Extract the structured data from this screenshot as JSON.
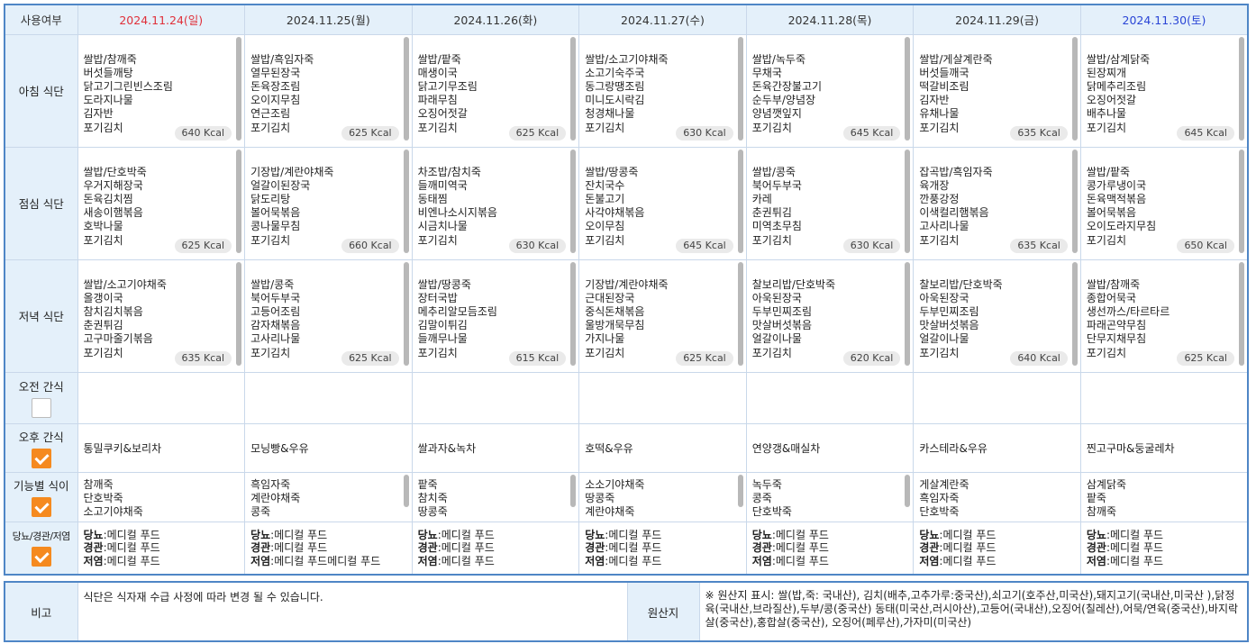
{
  "header": {
    "col_label": "사용여부",
    "days": [
      {
        "date": "2024.11.24(일)",
        "type": "sun"
      },
      {
        "date": "2024.11.25(월)",
        "type": ""
      },
      {
        "date": "2024.11.26(화)",
        "type": ""
      },
      {
        "date": "2024.11.27(수)",
        "type": ""
      },
      {
        "date": "2024.11.28(목)",
        "type": ""
      },
      {
        "date": "2024.11.29(금)",
        "type": ""
      },
      {
        "date": "2024.11.30(토)",
        "type": "sat"
      }
    ]
  },
  "meals": [
    {
      "label": "아침 식단",
      "days": [
        {
          "items": [
            "쌀밥/참깨죽",
            "버섯들깨탕",
            "닭고기그린빈스조림",
            "도라지나물",
            "김자반",
            "포기김치"
          ],
          "kcal": "640 Kcal"
        },
        {
          "items": [
            "쌀밥/흑임자죽",
            "열무된장국",
            "돈육장조림",
            "오이지무침",
            "연근조림",
            "포기김치"
          ],
          "kcal": "625 Kcal"
        },
        {
          "items": [
            "쌀밥/팥죽",
            "매생이국",
            "닭고기무조림",
            "파래무침",
            "오징어젓갈",
            "포기김치"
          ],
          "kcal": "625 Kcal"
        },
        {
          "items": [
            "쌀밥/소고기야채죽",
            "소고기숙주국",
            "동그랑땡조림",
            "미니도시락김",
            "청경채나물",
            "포기김치"
          ],
          "kcal": "630 Kcal"
        },
        {
          "items": [
            "쌀밥/녹두죽",
            "무채국",
            "돈육간장불고기",
            "순두부/양념장",
            "양념깻잎지",
            "포기김치"
          ],
          "kcal": "645 Kcal"
        },
        {
          "items": [
            "쌀밥/게살계란죽",
            "버섯들깨국",
            "떡갈비조림",
            "김자반",
            "유채나물",
            "포기김치"
          ],
          "kcal": "635 Kcal"
        },
        {
          "items": [
            "쌀밥/삼계닭죽",
            "된장찌개",
            "닭메추리조림",
            "오징어젓갈",
            "배추나물",
            "포기김치"
          ],
          "kcal": "645 Kcal"
        }
      ]
    },
    {
      "label": "점심 식단",
      "days": [
        {
          "items": [
            "쌀밥/단호박죽",
            "우거지해장국",
            "돈육김치찜",
            "새송이햄볶음",
            "호박나물",
            "포기김치"
          ],
          "kcal": "625 Kcal"
        },
        {
          "items": [
            "기장밥/계란야채죽",
            "얼갈이된장국",
            "닭도리탕",
            "볼어묵볶음",
            "콩나물무침",
            "포기김치"
          ],
          "kcal": "660 Kcal"
        },
        {
          "items": [
            "차조밥/참치죽",
            "들깨미역국",
            "동태찜",
            "비엔나소시지볶음",
            "시금치나물",
            "포기김치"
          ],
          "kcal": "630 Kcal"
        },
        {
          "items": [
            "쌀밥/땅콩죽",
            "잔치국수",
            "돈불고기",
            "사각야채볶음",
            "오이무침",
            "포기김치"
          ],
          "kcal": "645 Kcal"
        },
        {
          "items": [
            "쌀밥/콩죽",
            "북어두부국",
            "카레",
            "춘권튀김",
            "미역초무침",
            "포기김치"
          ],
          "kcal": "630 Kcal"
        },
        {
          "items": [
            "잡곡밥/흑임자죽",
            "육개장",
            "깐풍강정",
            "이색컬리햄볶음",
            "고사리나물",
            "포기김치"
          ],
          "kcal": "635 Kcal"
        },
        {
          "items": [
            "쌀밥/팥죽",
            "콩가루냉이국",
            "돈육맥적볶음",
            "볼어묵볶음",
            "오이도라지무침",
            "포기김치"
          ],
          "kcal": "650 Kcal"
        }
      ]
    },
    {
      "label": "저녁 식단",
      "days": [
        {
          "items": [
            "쌀밥/소고기야채죽",
            "올갱이국",
            "참치김치볶음",
            "춘권튀김",
            "고구마줄기볶음",
            "포기김치"
          ],
          "kcal": "635 Kcal"
        },
        {
          "items": [
            "쌀밥/콩죽",
            "북어두부국",
            "고등어조림",
            "감자채볶음",
            "고사리나물",
            "포기김치"
          ],
          "kcal": "625 Kcal"
        },
        {
          "items": [
            "쌀밥/땅콩죽",
            "장터국밥",
            "메추리알모듬조림",
            "김말이튀김",
            "들깨무나물",
            "포기김치"
          ],
          "kcal": "615 Kcal"
        },
        {
          "items": [
            "기장밥/계란야채죽",
            "근대된장국",
            "중식돈채볶음",
            "울방개묵무침",
            "가지나물",
            "포기김치"
          ],
          "kcal": "625 Kcal"
        },
        {
          "items": [
            "찰보리밥/단호박죽",
            "아욱된장국",
            "두부민찌조림",
            "맛살버섯볶음",
            "얼갈이나물",
            "포기김치"
          ],
          "kcal": "620 Kcal"
        },
        {
          "items": [
            "찰보리밥/단호박죽",
            "아욱된장국",
            "두부민찌조림",
            "맛살버섯볶음",
            "얼갈이나물",
            "포기김치"
          ],
          "kcal": "640 Kcal"
        },
        {
          "items": [
            "쌀밥/참깨죽",
            "종합어묵국",
            "생선까스/타르타르",
            "파래곤약무침",
            "단무지채무침",
            "포기김치"
          ],
          "kcal": "625 Kcal"
        }
      ]
    }
  ],
  "am_snack": {
    "label": "오전 간식",
    "checked": false,
    "items": [
      "",
      "",
      "",
      "",
      "",
      "",
      ""
    ]
  },
  "pm_snack": {
    "label": "오후 간식",
    "checked": true,
    "items": [
      "통밀쿠키&보리차",
      "모닝빵&우유",
      "쌀과자&녹차",
      "호떡&우유",
      "연양갱&매실차",
      "카스테라&우유",
      "찐고구마&둥굴레차"
    ]
  },
  "functional": {
    "label": "기능별 식이",
    "checked": true,
    "days": [
      [
        "참깨죽",
        "단호박죽",
        "소고기야채죽"
      ],
      [
        "흑임자죽",
        "계란야채죽",
        "콩죽"
      ],
      [
        "팥죽",
        "참치죽",
        "땅콩죽"
      ],
      [
        "소소기야채죽",
        "땅콩죽",
        "계란야채죽"
      ],
      [
        "녹두죽",
        "콩죽",
        "단호박죽"
      ],
      [
        "게살계란죽",
        "흑임자죽",
        "단호박죽"
      ],
      [
        "삼계닭죽",
        "팥죽",
        "참깨죽"
      ]
    ]
  },
  "diet": {
    "label": "당뇨/경관/저염",
    "checked": true,
    "days": [
      {
        "d": "메디컬 푸드",
        "g": "메디컬 푸드",
        "j": "메디컬 푸드"
      },
      {
        "d": "메디컬 푸드",
        "g": "메디컬 푸드",
        "j": "메디컬 푸드메디컬 푸드"
      },
      {
        "d": "메디컬 푸드",
        "g": "메디컬 푸드",
        "j": "메디컬 푸드"
      },
      {
        "d": "메디컬 푸드",
        "g": "메디컬 푸드",
        "j": "메디컬 푸드"
      },
      {
        "d": "메디컬 푸드",
        "g": "메디컬 푸드",
        "j": "메디컬 푸드"
      },
      {
        "d": "메디컬 푸드",
        "g": "메디컬 푸드",
        "j": "메디컬 푸드"
      },
      {
        "d": "메디컬 푸드",
        "g": "메디컬 푸드",
        "j": "메디컬 푸드"
      }
    ],
    "labels": {
      "d": "당뇨",
      "g": "경관",
      "j": "저염"
    }
  },
  "note": {
    "label": "비고",
    "text": "식단은 식자재 수급 사정에 따라 변경 될 수 있습니다.",
    "origin_label": "원산지",
    "origin_text": "※ 원산지 표시: 쌀(밥,죽: 국내산), 김치(배추,고추가루:중국산),쇠고기(호주산,미국산),돼지고기(국내산,미국산 ),닭정육(국내산,브라질산),두부/콩(중국산) 동태(미국산,러시아산),고등어(국내산),오징어(칠레산),어묵/연육(중국산),바지락살(중국산),홍합살(중국산), 오징어(페루산),가자미(미국산)"
  },
  "colors": {
    "border": "#4f86c6",
    "header_bg": "#e4f0fa",
    "check": "#f58a1f",
    "sun": "#e0303a",
    "sat": "#2a45d6"
  }
}
